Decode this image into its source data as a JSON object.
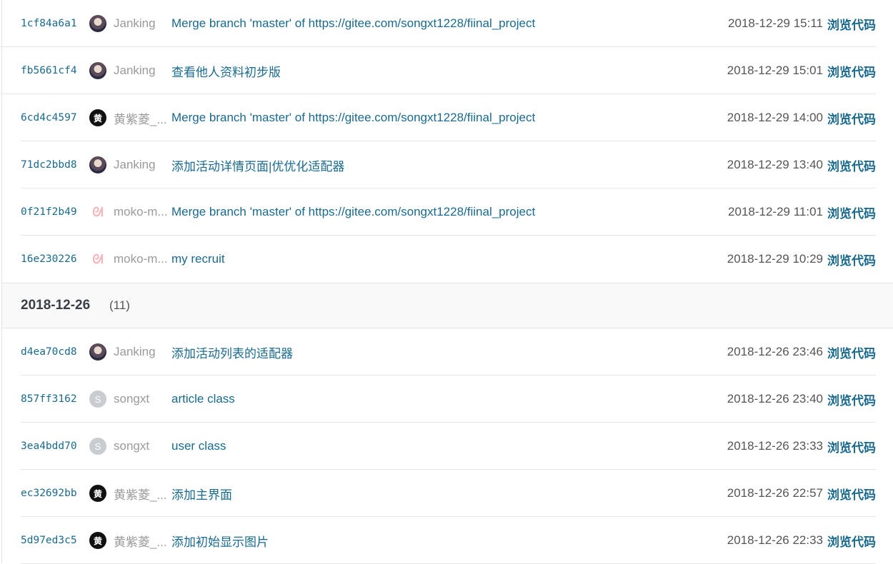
{
  "groups": [
    {
      "commits": [
        {
          "hash": "1cf84a6a1",
          "avatar": {
            "type": "photo",
            "glyph": ""
          },
          "author": "Janking",
          "message": "Merge branch 'master' of https://gitee.com/songxt1228/fiinal_project",
          "time": "2018-12-29 15:11",
          "browse": "浏览代码"
        },
        {
          "hash": "fb5661cf4",
          "avatar": {
            "type": "photo",
            "glyph": ""
          },
          "author": "Janking",
          "message": "查看他人资料初步版",
          "time": "2018-12-29 15:01",
          "browse": "浏览代码"
        },
        {
          "hash": "6cd4c4597",
          "avatar": {
            "type": "black",
            "glyph": "黄"
          },
          "author": "黄紫菱_...",
          "message": "Merge branch 'master' of https://gitee.com/songxt1228/fiinal_project",
          "time": "2018-12-29 14:00",
          "browse": "浏览代码"
        },
        {
          "hash": "71dc2bbd8",
          "avatar": {
            "type": "photo",
            "glyph": ""
          },
          "author": "Janking",
          "message": "添加活动详情页面|优优化适配器",
          "time": "2018-12-29 13:40",
          "browse": "浏览代码"
        },
        {
          "hash": "0f21f2b49",
          "avatar": {
            "type": "bunny",
            "glyph": "ᘛ"
          },
          "author": "moko-m...",
          "message": "Merge branch 'master' of https://gitee.com/songxt1228/fiinal_project",
          "time": "2018-12-29 11:01",
          "browse": "浏览代码"
        },
        {
          "hash": "16e230226",
          "avatar": {
            "type": "bunny",
            "glyph": "ᘛ"
          },
          "author": "moko-m...",
          "message": "my recruit",
          "time": "2018-12-29 10:29",
          "browse": "浏览代码"
        }
      ]
    },
    {
      "date": "2018-12-26",
      "count": "(11)",
      "commits": [
        {
          "hash": "d4ea70cd8",
          "avatar": {
            "type": "photo",
            "glyph": ""
          },
          "author": "Janking",
          "message": "添加活动列表的适配器",
          "time": "2018-12-26 23:46",
          "browse": "浏览代码"
        },
        {
          "hash": "857ff3162",
          "avatar": {
            "type": "gray",
            "glyph": "S"
          },
          "author": "songxt",
          "message": "article class",
          "time": "2018-12-26 23:40",
          "browse": "浏览代码"
        },
        {
          "hash": "3ea4bdd70",
          "avatar": {
            "type": "gray",
            "glyph": "S"
          },
          "author": "songxt",
          "message": "user class",
          "time": "2018-12-26 23:33",
          "browse": "浏览代码"
        },
        {
          "hash": "ec32692bb",
          "avatar": {
            "type": "black",
            "glyph": "黄"
          },
          "author": "黄紫菱_...",
          "message": "添加主界面",
          "time": "2018-12-26 22:57",
          "browse": "浏览代码"
        },
        {
          "hash": "5d97ed3c5",
          "avatar": {
            "type": "black",
            "glyph": "黄"
          },
          "author": "黄紫菱_...",
          "message": "添加初始显示图片",
          "time": "2018-12-26 22:33",
          "browse": "浏览代码"
        }
      ]
    }
  ]
}
